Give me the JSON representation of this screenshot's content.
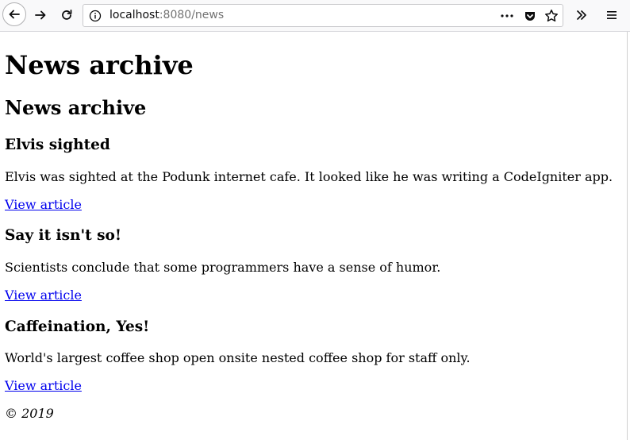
{
  "browser": {
    "url_host": "localhost",
    "url_path": ":8080/news",
    "icons": [
      "back-arrow-icon",
      "forward-arrow-icon",
      "reload-icon",
      "info-icon",
      "more-dots-icon",
      "pocket-icon",
      "bookmark-star-icon",
      "overflow-chevrons-icon",
      "hamburger-menu-icon"
    ]
  },
  "page": {
    "heading": "News archive",
    "subheading": "News archive",
    "items": [
      {
        "title": "Elvis sighted",
        "text": "Elvis was sighted at the Podunk internet cafe. It looked like he was writing a CodeIgniter app.",
        "link": "View article"
      },
      {
        "title": "Say it isn't so!",
        "text": "Scientists conclude that some programmers have a sense of humor.",
        "link": "View article"
      },
      {
        "title": "Caffeination, Yes!",
        "text": "World's largest coffee shop open onsite nested coffee shop for staff only.",
        "link": "View article"
      }
    ],
    "footer": "© 2019"
  }
}
